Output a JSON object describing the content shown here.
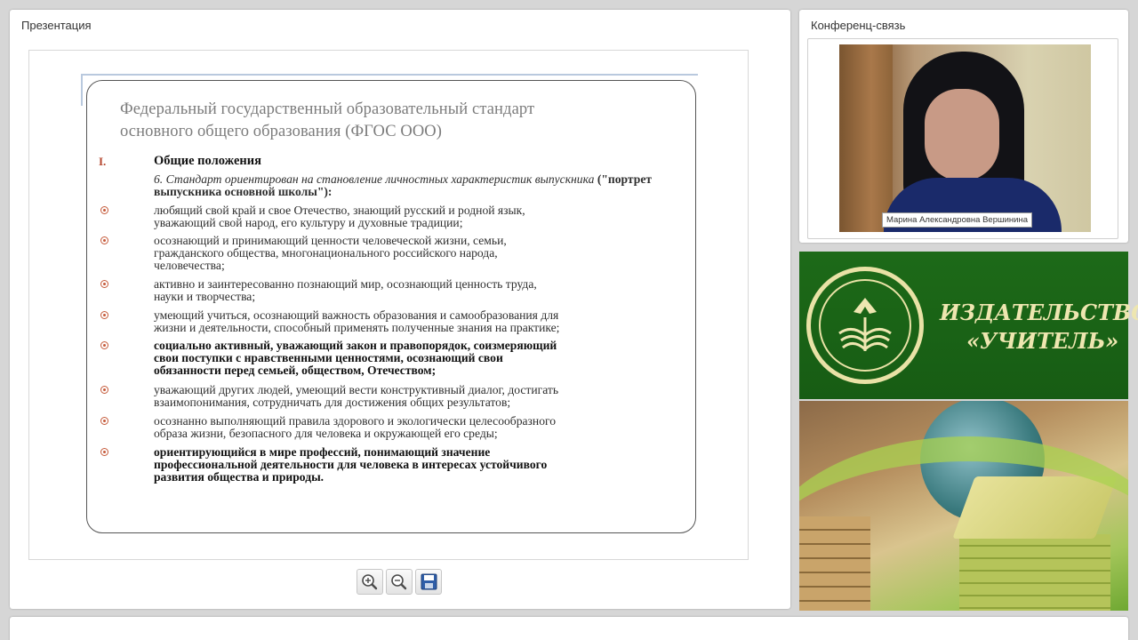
{
  "presentation": {
    "title": "Презентация",
    "slide": {
      "title_line1": "Федеральный государственный образовательный стандарт",
      "title_line2": "основного общего образования (ФГОС ООО)",
      "section_number": "I.",
      "section_heading": "Общие положения",
      "intro_italic": "6. Стандарт ориентирован на становление личностных характеристик выпускника",
      "intro_italic_line2": "выпускника",
      "intro_bold": "(\"портрет выпускника основной школы\"):",
      "bullets": [
        {
          "lines": [
            "любящий свой край и свое Отечество, знающий русский и родной язык,",
            "уважающий свой народ, его культуру и духовные традиции;"
          ],
          "bold": false
        },
        {
          "lines": [
            "осознающий и принимающий ценности человеческой жизни, семьи,",
            "гражданского общества, многонационального российского народа,",
            "человечества;"
          ],
          "bold": false
        },
        {
          "lines": [
            "активно и заинтересованно познающий мир, осознающий ценность труда,",
            "науки и творчества;"
          ],
          "bold": false
        },
        {
          "lines": [
            "умеющий учиться, осознающий важность образования и самообразования для",
            "жизни и деятельности, способный применять полученные знания на практике;"
          ],
          "bold": false
        },
        {
          "lines": [
            "социально активный, уважающий закон и правопорядок, соизмеряющий",
            "свои поступки с нравственными ценностями, осознающий свои",
            "обязанности перед семьей, обществом, Отечеством;"
          ],
          "bold": true
        },
        {
          "lines": [
            "уважающий других людей, умеющий вести конструктивный диалог, достигать",
            "взаимопонимания, сотрудничать для достижения общих результатов;"
          ],
          "bold": false
        },
        {
          "lines": [
            "осознанно выполняющий правила здорового и экологически целесообразного",
            "образа жизни, безопасного для человека и окружающей его среды;"
          ],
          "bold": false
        },
        {
          "lines": [
            "ориентирующийся в мире профессий, понимающий значение",
            "профессиональной деятельности для человека в интересах устойчивого",
            "развития общества и природы."
          ],
          "bold": true
        }
      ]
    },
    "toolbar": {
      "zoom_in_icon": "zoom-in-icon",
      "zoom_out_icon": "zoom-out-icon",
      "save_icon": "save-icon"
    }
  },
  "conference": {
    "title": "Конференц-связь",
    "speaker_name": "Марина Александровна Вершинина"
  },
  "logo": {
    "line1": "ИЗДАТЕЛЬСТВО",
    "line2": "«УЧИТЕЛЬ»"
  },
  "colors": {
    "logo_green": "#1d6a18",
    "logo_text": "#eee6b0",
    "bullet_accent": "#c55a3a"
  }
}
